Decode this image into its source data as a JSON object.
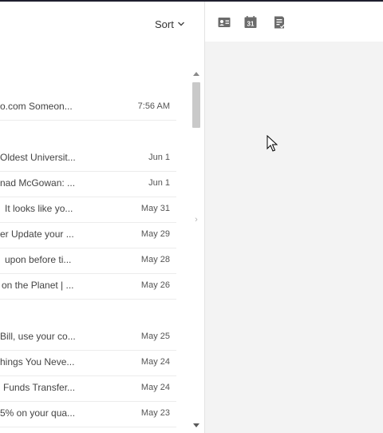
{
  "list": {
    "sort_label": "Sort",
    "messages": [
      {
        "preview": "o.com Someon...",
        "date": "7:56 AM"
      },
      {
        "preview": "Oldest Universit...",
        "date": "Jun 1"
      },
      {
        "preview": "nad McGowan: ...",
        "date": "Jun 1"
      },
      {
        "preview": "It looks like yo...",
        "date": "May 31"
      },
      {
        "preview": "er Update your ...",
        "date": "May 29"
      },
      {
        "preview": "upon before ti...",
        "date": "May 28"
      },
      {
        "preview": "on the Planet | ...",
        "date": "May 26"
      },
      {
        "preview": "Bill, use your co...",
        "date": "May 25"
      },
      {
        "preview": "hings You Neve...",
        "date": "May 24"
      },
      {
        "preview": "Funds Transfer...",
        "date": "May 24"
      },
      {
        "preview": "5% on your qua...",
        "date": "May 23"
      }
    ]
  },
  "toolbar": {
    "icons": [
      "contact-card-icon",
      "calendar-icon",
      "task-list-icon"
    ],
    "calendar_day": "31"
  },
  "colors": {
    "accent_icon": "#6b6b6b",
    "reading_bg": "#f3f3f3",
    "row_border": "#ececec"
  }
}
